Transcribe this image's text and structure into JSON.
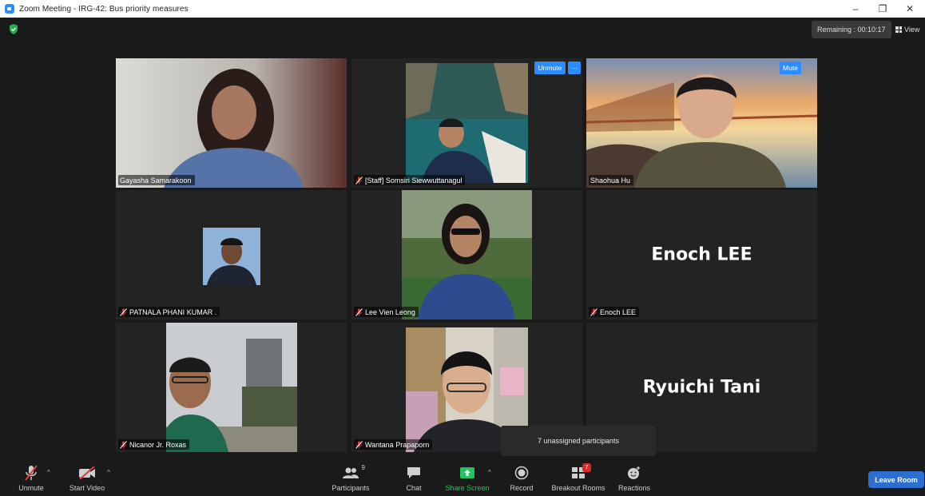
{
  "window": {
    "title": "Zoom Meeting - IRG-42: Bus priority measures",
    "minimize": "–",
    "maximize": "❐",
    "close": "✕"
  },
  "meeting": {
    "remaining": "Remaining : 00:10:17",
    "view_label": "View"
  },
  "tiles": [
    {
      "name": "Gayasha Samarakoon",
      "muted": false
    },
    {
      "name": "[Staff] Somsiri Siewwuttanagul",
      "muted": true,
      "unmute_label": "Unmute",
      "more_label": "···"
    },
    {
      "name": "Shaohua Hu",
      "muted": false,
      "mute_label": "Mute",
      "active_speaker": true
    },
    {
      "name": "PATNALA PHANI KUMAR .",
      "muted": true
    },
    {
      "name": "Lee Vien Leong",
      "muted": true
    },
    {
      "name": "Enoch LEE",
      "muted": true,
      "display_name": "Enoch LEE"
    },
    {
      "name": "Nicanor Jr. Roxas",
      "muted": true
    },
    {
      "name": "Wantana Prapaporn",
      "muted": true
    },
    {
      "name": "",
      "display_name": "Ryuichi Tani"
    }
  ],
  "tooltip": "7 unassigned participants",
  "toolbar": {
    "unmute": "Unmute",
    "start_video": "Start Video",
    "participants": "Participants",
    "participants_count": "9",
    "chat": "Chat",
    "share_screen": "Share Screen",
    "record": "Record",
    "breakout_rooms": "Breakout Rooms",
    "breakout_badge": "7",
    "reactions": "Reactions",
    "leave_room": "Leave Room"
  },
  "colors": {
    "active_speaker_border": "#c8e35a",
    "accent_blue": "#2d8cff",
    "share_green": "#22c55e",
    "muted_red": "#e03a3a"
  }
}
